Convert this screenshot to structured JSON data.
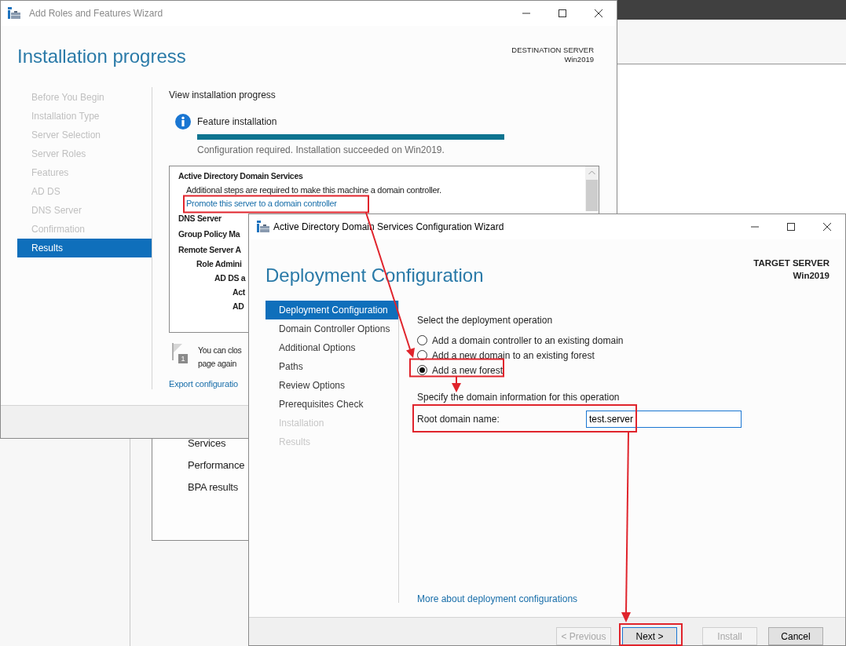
{
  "background_window": {
    "items": [
      "Services",
      "Performance",
      "BPA results"
    ]
  },
  "roles_wizard": {
    "title": "Add Roles and Features Wizard",
    "heading": "Installation progress",
    "destination_label": "DESTINATION SERVER",
    "destination_server": "Win2019",
    "nav": [
      {
        "label": "Before You Begin",
        "selected": false
      },
      {
        "label": "Installation Type",
        "selected": false
      },
      {
        "label": "Server Selection",
        "selected": false
      },
      {
        "label": "Server Roles",
        "selected": false
      },
      {
        "label": "Features",
        "selected": false
      },
      {
        "label": "AD DS",
        "selected": false
      },
      {
        "label": "DNS Server",
        "selected": false
      },
      {
        "label": "Confirmation",
        "selected": false
      },
      {
        "label": "Results",
        "selected": true
      }
    ],
    "intro": "View installation progress",
    "progress": {
      "label": "Feature installation",
      "level": 1,
      "status": "Configuration required. Installation succeeded on Win2019."
    },
    "results": [
      {
        "text": "Active Directory Domain Services",
        "kind": "heading",
        "children": [
          {
            "text": "Additional steps are required to make this machine a domain controller.",
            "kind": "text"
          },
          {
            "text": "Promote this server to a domain controller",
            "kind": "link"
          }
        ]
      },
      {
        "text": "DNS Server",
        "kind": "heading"
      },
      {
        "text": "Group Policy Ma",
        "kind": "heading"
      },
      {
        "text": "Remote Server A",
        "kind": "heading",
        "children": [
          {
            "text": "Role Admini",
            "kind": "heading",
            "children": [
              {
                "text": "AD DS a",
                "kind": "heading",
                "children": [
                  {
                    "text": "Act",
                    "kind": "heading"
                  },
                  {
                    "text": "AD",
                    "kind": "heading"
                  }
                ]
              }
            ]
          }
        ]
      }
    ],
    "note": {
      "badge": "1",
      "lines": [
        "You can clos",
        "page again"
      ]
    },
    "export_link": "Export configuratio"
  },
  "adds_wizard": {
    "title": "Active Directory Domain Services Configuration Wizard",
    "heading": "Deployment Configuration",
    "target_label": "TARGET SERVER",
    "target_server": "Win2019",
    "nav": [
      {
        "label": "Deployment Configuration",
        "selected": true,
        "disabled": false
      },
      {
        "label": "Domain Controller Options",
        "selected": false,
        "disabled": false
      },
      {
        "label": "Additional Options",
        "selected": false,
        "disabled": false
      },
      {
        "label": "Paths",
        "selected": false,
        "disabled": false
      },
      {
        "label": "Review Options",
        "selected": false,
        "disabled": false
      },
      {
        "label": "Prerequisites Check",
        "selected": false,
        "disabled": false
      },
      {
        "label": "Installation",
        "selected": false,
        "disabled": true
      },
      {
        "label": "Results",
        "selected": false,
        "disabled": true
      }
    ],
    "operation_label": "Select the deployment operation",
    "operations": [
      {
        "label": "Add a domain controller to an existing domain",
        "selected": false
      },
      {
        "label": "Add a new domain to an existing forest",
        "selected": false
      },
      {
        "label": "Add a new forest",
        "selected": true
      }
    ],
    "domain_label": "Specify the domain information for this operation",
    "root_domain": {
      "label": "Root domain name:",
      "value": "test.server"
    },
    "more_link": "More about deployment configurations",
    "buttons": [
      {
        "label": "< Previous",
        "disabled": true,
        "default": false
      },
      {
        "label": "Next >",
        "disabled": false,
        "default": true
      },
      {
        "label": "Install",
        "disabled": true,
        "default": false
      },
      {
        "label": "Cancel",
        "disabled": false,
        "default": false
      }
    ]
  }
}
